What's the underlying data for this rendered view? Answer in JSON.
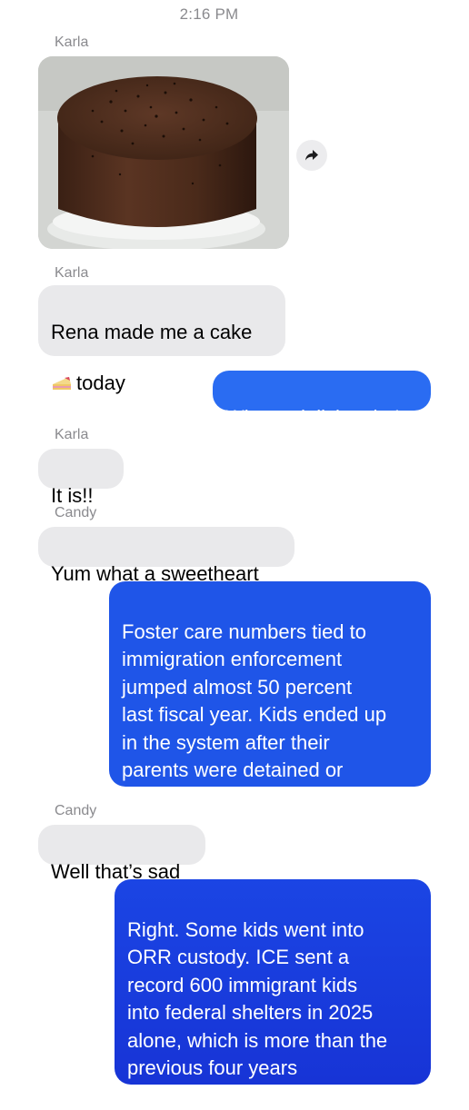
{
  "status": {
    "time": "2:16 PM"
  },
  "messages": [
    {
      "sender": "Karla",
      "type": "image",
      "image_alt": "Chocolate frosted layer cake with sprinkles"
    },
    {
      "sender": "Karla",
      "type": "text",
      "text_line1": "Rena made me a cake",
      "emoji": "🍰",
      "text_line2": "today"
    },
    {
      "sender": "me",
      "type": "text",
      "text": "What a delish cake!"
    },
    {
      "sender": "Karla",
      "type": "text",
      "text": "It is!!"
    },
    {
      "sender": "Candy",
      "type": "text",
      "text": "Yum what a sweetheart"
    },
    {
      "sender": "me",
      "type": "text",
      "text": "Foster care numbers tied to\nimmigration enforcement\njumped almost 50 percent\nlast fiscal year. Kids ended up\nin the system after their\nparents were detained or\ndeported by ICE."
    },
    {
      "sender": "Candy",
      "type": "text",
      "text": "Well that’s sad"
    },
    {
      "sender": "me",
      "type": "text",
      "text": "Right. Some kids went into\nORR custody. ICE sent a\nrecord 600 immigrant kids\ninto federal shelters in 2025\nalone, which is more than the\nprevious four years\ncombined."
    }
  ],
  "icons": {
    "share": "share-forward-icon"
  },
  "colors": {
    "incoming_bubble": "#e9e9eb",
    "outgoing_bubble": "#2a6cf2",
    "sender_label": "#8a8a8e"
  }
}
